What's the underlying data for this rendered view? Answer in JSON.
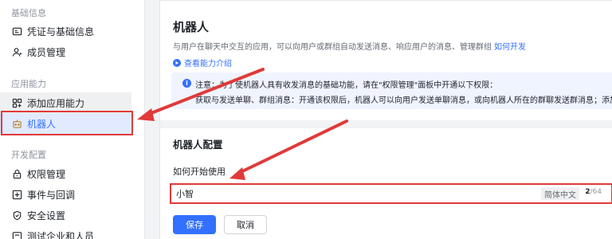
{
  "sidebar": {
    "groups": [
      {
        "title": "基础信息",
        "items": [
          {
            "label": "凭证与基础信息",
            "icon": "credential-icon"
          },
          {
            "label": "成员管理",
            "icon": "user-icon"
          }
        ]
      },
      {
        "title": "应用能力",
        "items": [
          {
            "label": "添加应用能力",
            "icon": "grid-plus-icon"
          },
          {
            "label": "机器人",
            "icon": "robot-icon",
            "active": true
          }
        ]
      },
      {
        "title": "开发配置",
        "items": [
          {
            "label": "权限管理",
            "icon": "lock-icon"
          },
          {
            "label": "事件与回调",
            "icon": "event-icon"
          },
          {
            "label": "安全设置",
            "icon": "shield-icon"
          },
          {
            "label": "测试企业和人员",
            "icon": "test-icon"
          }
        ]
      }
    ]
  },
  "main": {
    "title": "机器人",
    "description": "与用户在聊天中交互的应用，可以向用户或群组自动发送消息、响应用户的消息、管理群组",
    "how_to_dev_link": "如何开发",
    "capability_link": "查看能力介绍",
    "notice": {
      "line1": "注意：为了使机器人具有收发消息的基础功能，请在\"权限管理\"面板中开通以下权限：",
      "line2": "获取与发送单聊、群组消息：开通该权限后，机器人可以向用户发送单聊消息，或向机器人所在的群聊发送群消息；添加\"接收"
    },
    "config_title": "机器人配置",
    "how_to_start_label": "如何开始使用",
    "name_input": {
      "value": "小智",
      "language_tag": "简体中文",
      "count_current": "2",
      "count_max": "/64"
    },
    "save_label": "保存",
    "cancel_label": "取消"
  },
  "colors": {
    "accent": "#3370ff",
    "highlight_border": "#e03a3a",
    "active_bg": "#e1eaff",
    "notice_bg": "#f0f4ff"
  }
}
